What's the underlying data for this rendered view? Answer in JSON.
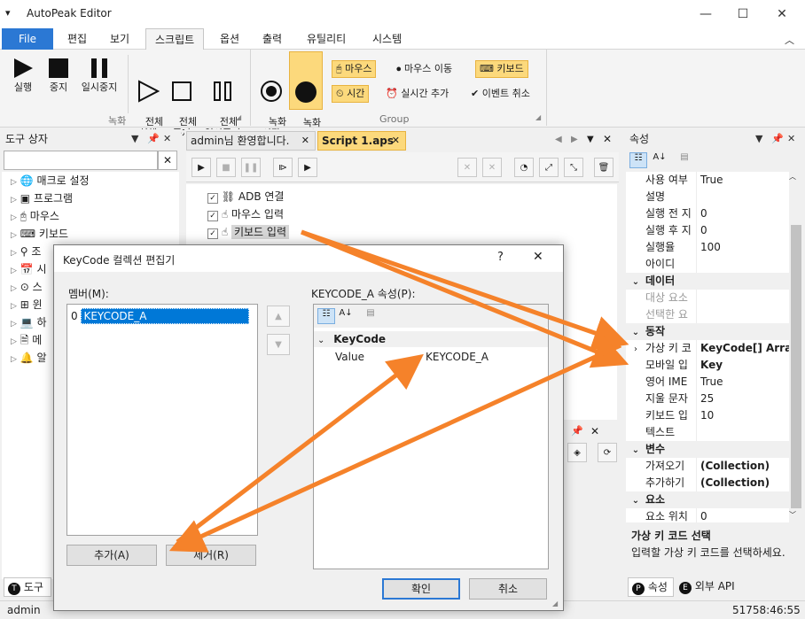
{
  "window": {
    "title": "AutoPeak Editor",
    "minimize_glyph": "—",
    "maximize_glyph": "☐",
    "close_glyph": "✕"
  },
  "menu": {
    "tabs": [
      "File",
      "편집",
      "보기",
      "스크립트",
      "옵션",
      "출력",
      "유틸리티",
      "시스템"
    ],
    "active_tab": "스크립트"
  },
  "ribbon": {
    "groups": {
      "record": "녹화",
      "group": "Group"
    },
    "run": {
      "run": "실행",
      "stop": "중지",
      "pause": "일시중지"
    },
    "all": {
      "run": "전체\n실행",
      "stop": "전체\n중지",
      "pause": "전체\n일시중지"
    },
    "record": {
      "start": "녹화\n시작",
      "stop": "녹화\n중지"
    },
    "options": {
      "mouse": "마우스",
      "mouse_move": "마우스 이동",
      "keyboard": "키보드",
      "time": "시간",
      "realtime_add": "실시간 추가",
      "event_cancel": "이벤트 취소"
    }
  },
  "toolbox": {
    "title": "도구 상자",
    "search_value": "",
    "items": [
      "매크로 설정",
      "프로그램",
      "마우스",
      "키보드",
      "조",
      "시",
      "스",
      "윈",
      "하",
      "메",
      "알"
    ],
    "bottom_tab": "도구"
  },
  "doc_tabs": {
    "tab1": "admin님 환영합니다.",
    "tab2": "Script 1.aps"
  },
  "script": {
    "lines": [
      "ADB 연결",
      "마우스 입력",
      "키보드 입력"
    ]
  },
  "properties": {
    "title": "속성",
    "rows": [
      {
        "type": "row",
        "name": "사용 여부",
        "value": "True"
      },
      {
        "type": "row",
        "name": "설명",
        "value": ""
      },
      {
        "type": "row",
        "name": "실행 전 지",
        "value": "0"
      },
      {
        "type": "row",
        "name": "실행 후 지",
        "value": "0"
      },
      {
        "type": "row",
        "name": "실행율",
        "value": "100"
      },
      {
        "type": "row",
        "name": "아이디",
        "value": ""
      },
      {
        "type": "cat",
        "name": "데이터"
      },
      {
        "type": "row",
        "name": "대상 요소",
        "value": "",
        "dim": true
      },
      {
        "type": "row",
        "name": "선택한 요",
        "value": "",
        "dim": true
      },
      {
        "type": "cat",
        "name": "동작"
      },
      {
        "type": "row",
        "name": "가상 키 코",
        "value": "KeyCode[] Array",
        "bold": true,
        "expander": true
      },
      {
        "type": "row",
        "name": "모바일 입",
        "value": "Key",
        "bold": true
      },
      {
        "type": "row",
        "name": "영어 IME",
        "value": "True"
      },
      {
        "type": "row",
        "name": "지울 문자",
        "value": "25"
      },
      {
        "type": "row",
        "name": "키보드 입",
        "value": "10"
      },
      {
        "type": "row",
        "name": "텍스트",
        "value": ""
      },
      {
        "type": "cat",
        "name": "변수"
      },
      {
        "type": "row",
        "name": "가져오기",
        "value": "(Collection)",
        "bold": true
      },
      {
        "type": "row",
        "name": "추가하기",
        "value": "(Collection)",
        "bold": true
      },
      {
        "type": "cat",
        "name": "요소"
      },
      {
        "type": "row",
        "name": "요소 위치",
        "value": "0"
      }
    ],
    "desc_title": "가상 키 코드 선택",
    "desc_text": "입력할 가상 키 코드를 선택하세요.",
    "bottom_tabs": [
      "속성",
      "외부 API"
    ]
  },
  "dialog": {
    "title": "KeyCode 컬렉션 편집기",
    "help": "?",
    "members_label": "멤버(M):",
    "members": [
      {
        "index": "0",
        "name": "KEYCODE_A"
      }
    ],
    "props_label": "KEYCODE_A 속성(P):",
    "category": "KeyCode",
    "prop_name": "Value",
    "prop_value": "KEYCODE_A",
    "add": "추가(A)",
    "remove": "제거(R)",
    "ok": "확인",
    "cancel": "취소"
  },
  "status": {
    "user": "admin",
    "time": "51758:46:55"
  },
  "colors": {
    "accent": "#2b78d4",
    "arrow": "#f5822a",
    "highlight": "#fcd97c"
  }
}
